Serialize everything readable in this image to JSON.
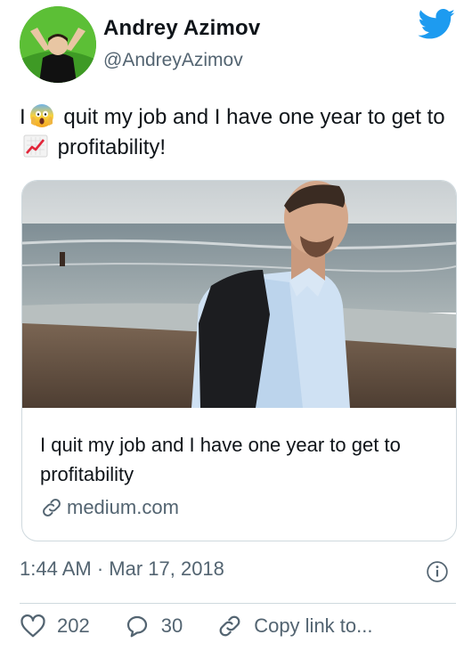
{
  "author": {
    "name": "Andrey Azimov",
    "handle": "@AndreyAzimov",
    "avatar_icon": "profile-photo"
  },
  "tweet": {
    "text_part1": "I",
    "emoji1": "face-screaming-in-fear",
    "text_part2": " quit my job and I have one year to get to",
    "emoji2": "chart-increasing",
    "text_part3": " profitability!"
  },
  "card": {
    "title": "I quit my job and I have one year to get to profitability",
    "domain": "medium.com",
    "image": "man-on-beach-photo"
  },
  "timestamp": "1:44 AM · Mar 17, 2018",
  "actions": {
    "likes": "202",
    "replies": "30",
    "copy_link": "Copy link to..."
  },
  "colors": {
    "twitter_blue": "#1d9bf0",
    "muted": "#536471",
    "border": "#cfd9de"
  }
}
